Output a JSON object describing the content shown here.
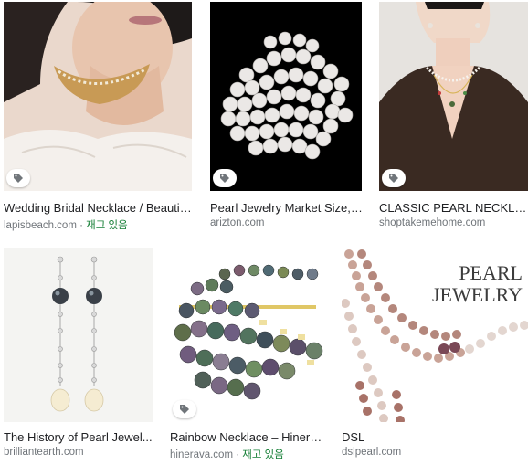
{
  "results": [
    {
      "title": "Wedding Bridal Necklace / Beautif...",
      "source": "lapisbeach.com",
      "separator": " · ",
      "stock": "재고 있음",
      "badge_icon": "tag-icon"
    },
    {
      "title": "Pearl Jewelry Market Size, ...",
      "source": "arizton.com",
      "separator": "",
      "stock": "",
      "badge_icon": "tag-icon"
    },
    {
      "title": "CLASSIC PEARL NECKLA...",
      "source": "shoptakemehome.com",
      "separator": "",
      "stock": "",
      "badge_icon": "tag-icon"
    },
    {
      "title": "The History of Pearl Jewel...",
      "source": "brilliantearth.com",
      "separator": "",
      "stock": "",
      "badge_icon": ""
    },
    {
      "title": "Rainbow Necklace – Hinera...",
      "source": "hinerava.com",
      "separator": " · ",
      "stock": "재고 있음",
      "badge_icon": "tag-icon"
    },
    {
      "title": "DSL",
      "source": "dslpearl.com",
      "separator": "",
      "stock": "",
      "badge_icon": ""
    }
  ],
  "image_text": {
    "pearl_jewelry_line1": "PEARL",
    "pearl_jewelry_line2": "JEWELRY"
  },
  "colors": {
    "stock_green": "#188038",
    "source_gray": "#70757a",
    "title_text": "#202124"
  }
}
